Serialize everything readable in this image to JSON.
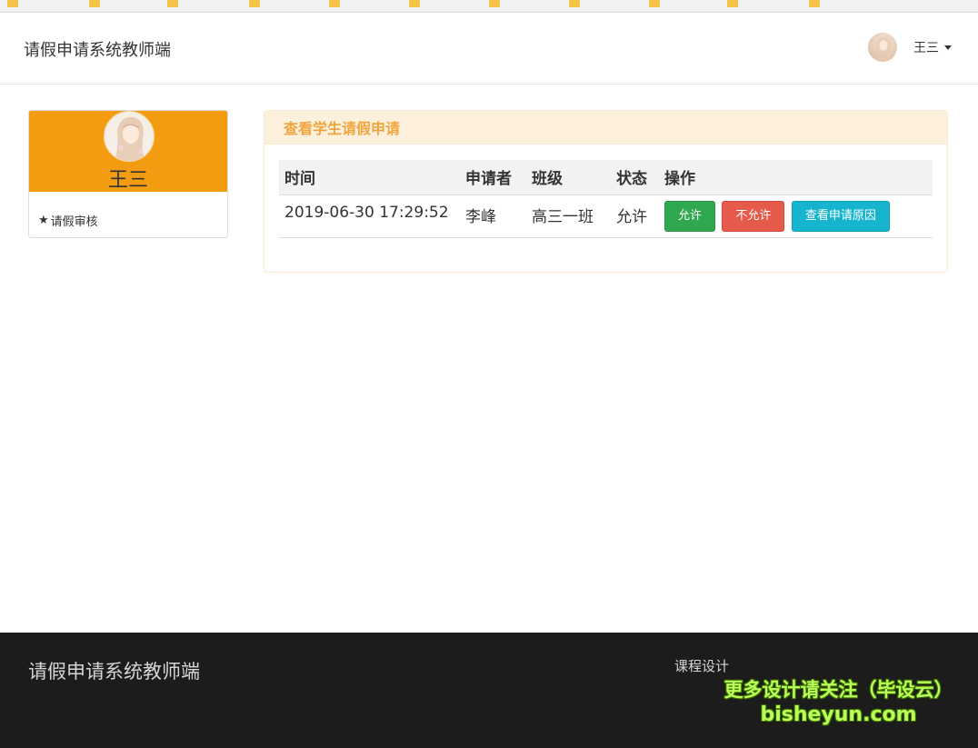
{
  "bookmarks": [],
  "navbar": {
    "brand": "请假申请系统教师端",
    "user_name": "王三",
    "avatar_icon": "avatar-anime-girl"
  },
  "profile": {
    "name": "王三",
    "header_color": "#f39c12",
    "nav_items": [
      {
        "icon": "star-icon",
        "label": "请假审核"
      }
    ]
  },
  "panel": {
    "title": "查看学生请假申请",
    "table": {
      "headers": [
        "时间",
        "申请者",
        "班级",
        "状态",
        "操作"
      ],
      "rows": [
        {
          "time": "2019-06-30 17:29:52",
          "applicant": "李峰",
          "class_name": "高三一班",
          "status": "允许",
          "actions": {
            "allow": "允许",
            "deny": "不允许",
            "view_reason": "查看申请原因"
          }
        }
      ]
    }
  },
  "footer": {
    "brand": "请假申请系统教师端",
    "link": "课程设计",
    "watermark": {
      "line1": "更多设计请关注（毕设云）",
      "line2": "bisheyun.com"
    }
  },
  "colors": {
    "success": "#2fa84f",
    "danger": "#e55a4a",
    "info": "#17b4cf",
    "panel_title": "#f0a53c",
    "footer_bg": "#1c1c1c"
  }
}
